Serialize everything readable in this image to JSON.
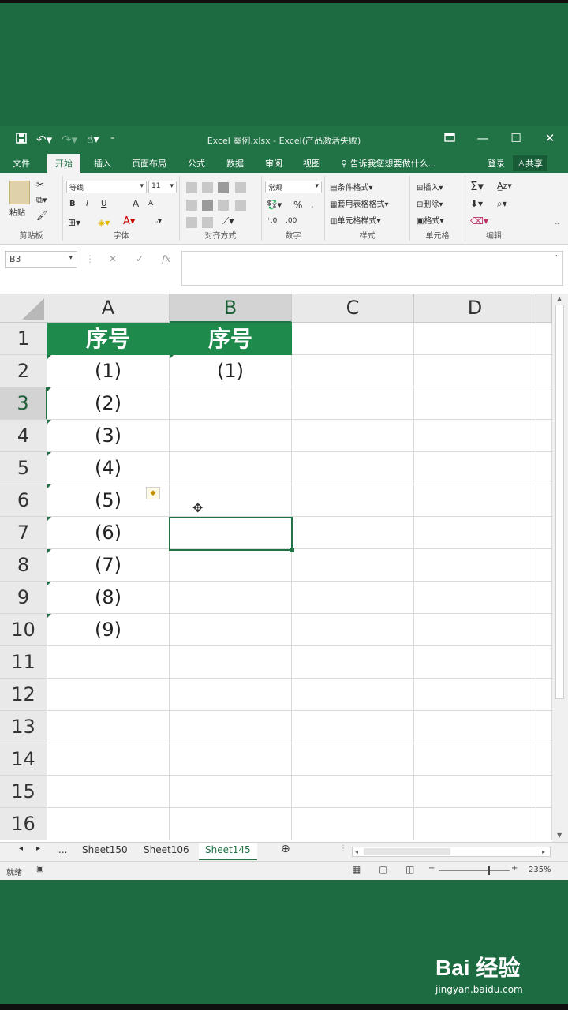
{
  "window": {
    "title": "Excel 案例.xlsx - Excel(产品激活失败)"
  },
  "tabs": [
    "文件",
    "开始",
    "插入",
    "页面布局",
    "公式",
    "数据",
    "审阅",
    "视图"
  ],
  "active_tab": "开始",
  "tell_me": "告诉我您想要做什么...",
  "login": "登录",
  "share": "共享",
  "ribbon": {
    "clipboard": {
      "label": "剪贴板",
      "paste": "粘贴"
    },
    "font": {
      "label": "字体",
      "name": "等线",
      "size": "11",
      "bold": "B",
      "italic": "I",
      "underline": "U",
      "grow": "A",
      "shrink": "A"
    },
    "alignment": {
      "label": "对齐方式"
    },
    "number": {
      "label": "数字",
      "format": "常规",
      "percent": "%"
    },
    "styles": {
      "label": "样式",
      "conditional": "条件格式",
      "table": "套用表格格式",
      "cell": "单元格样式"
    },
    "cells": {
      "label": "单元格",
      "insert": "插入",
      "delete": "删除",
      "format": "格式"
    },
    "editing": {
      "label": "编辑"
    }
  },
  "formula_bar": {
    "name_box": "B3",
    "value": ""
  },
  "columns": [
    "A",
    "B",
    "C",
    "D"
  ],
  "selected_column": "B",
  "rows": [
    "1",
    "2",
    "3",
    "4",
    "5",
    "6",
    "7",
    "8",
    "9",
    "10",
    "11",
    "12",
    "13",
    "14",
    "15",
    "16"
  ],
  "selected_row": "3",
  "cells": {
    "A1": "序号",
    "B1": "序号",
    "A2": "(1)",
    "A3": "(2)",
    "A4": "(3)",
    "A5": "(4)",
    "A6": "(5)",
    "A7": "(6)",
    "A8": "(7)",
    "A9": "(8)",
    "A10": "(9)",
    "B2": "(1)"
  },
  "sheets": {
    "nav_more": "...",
    "tabs": [
      "Sheet150",
      "Sheet106",
      "Sheet145"
    ],
    "active": "Sheet145"
  },
  "status": {
    "ready": "就绪",
    "zoom": "235%"
  },
  "watermark": {
    "brand": "Bai 经验",
    "url": "jingyan.baidu.com"
  },
  "colors": {
    "excel_green": "#217346",
    "header_fill": "#1e8a4b",
    "background": "#1d6b41"
  }
}
